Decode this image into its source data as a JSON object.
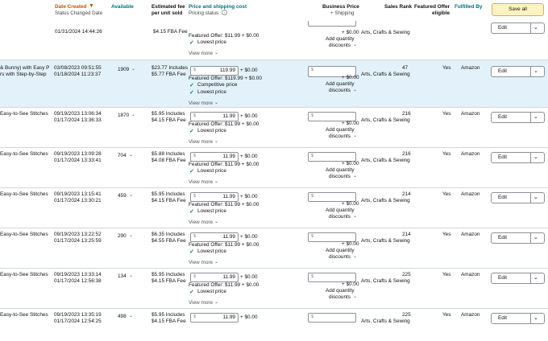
{
  "header": {
    "date_created": "Date Created",
    "date_sort_icon": "sort-down-icon",
    "status_changed_date": "Status Changed Date",
    "available": "Available",
    "estimated_fee": "Estimated fee",
    "per_unit_sold": "per unit sold",
    "price_shipping": "Price and shipping cost",
    "pricing_status": "Pricing status",
    "business_price": "Business Price",
    "plus_shipping": "+ Shipping",
    "sales_rank": "Sales Rank",
    "featured_offer": "Featured Offer",
    "eligible": "eligible",
    "fulfilled_by": "Fulfilled By",
    "save_all": "Save all"
  },
  "common": {
    "currency": "$",
    "plus_shipping_zero": "+ $0.00",
    "add_quantity": "Add quantity",
    "discounts": "discounts",
    "view_more": "View more",
    "lowest_price": "Lowest price",
    "competitive_price": "Competitive price",
    "category": "Arts, Crafts & Sewing",
    "edit": "Edit",
    "shipping_value": "+ $0.00"
  },
  "top_partial": {
    "date2": "01/31/2024 14:44:26",
    "fee2": "$4.15 FBA Fee",
    "featured": "Featured Offer: $11.99 + $0.00",
    "lowest": "Lowest price",
    "view_more": "View more",
    "biz_ship": "+ $0.00",
    "add_quantity": "Add quantity",
    "discounts": "discounts",
    "category": "Arts, Crafts & Sewing",
    "edit": "Edit"
  },
  "rows": [
    {
      "title1": "& Bunny) with Easy P",
      "title2": "rs with Step-by-Step",
      "date1": "03/08/2023 09:51:55",
      "date2": "01/18/2024 11:23:37",
      "available": "1909",
      "fee1": "$23.77 Includes",
      "fee2": "$5.77 FBA Fee",
      "price": "119.99",
      "featured": "Featured Offer: $119.99 + $0.00",
      "status1": "Competitive price",
      "status2": "Lowest price",
      "sales_rank": "47",
      "featured_eligible": "Yes",
      "fulfilled_by": "Amazon"
    },
    {
      "title1": "Easy-to-See Stitches",
      "date1": "09/19/2023 13:06:34",
      "date2": "01/17/2024 13:36:33",
      "available": "1870",
      "fee1": "$5.95 Includes",
      "fee2": "$4.15 FBA Fee",
      "price": "11.99",
      "featured": "Featured Offer: $11.99 + $0.00",
      "status1": "Lowest price",
      "sales_rank": "216",
      "featured_eligible": "Yes",
      "fulfilled_by": "Amazon"
    },
    {
      "title1": "Easy-to-See Stitches",
      "date1": "09/19/2023 13:09:28",
      "date2": "01/17/2024 13:33:41",
      "available": "704",
      "fee1": "$5.88 Includes",
      "fee2": "$4.08 FBA Fee",
      "price": "11.99",
      "featured": "Featured Offer: $11.99 + $0.00",
      "status1": "Lowest price",
      "sales_rank": "216",
      "featured_eligible": "Yes",
      "fulfilled_by": "Amazon"
    },
    {
      "title1": "Easy-to-See Stitches",
      "date1": "09/19/2023 13:15:41",
      "date2": "01/17/2024 13:30:21",
      "available": "459",
      "fee1": "$5.95 Includes",
      "fee2": "$4.15 FBA Fee",
      "price": "11.99",
      "featured": "Featured Offer: $11.99 + $0.00",
      "status1": "Lowest price",
      "sales_rank": "214",
      "featured_eligible": "Yes",
      "fulfilled_by": "Amazon"
    },
    {
      "title1": "Easy-to-See Stitches",
      "date1": "09/19/2023 13:22:52",
      "date2": "01/17/2024 13:25:59",
      "available": "290",
      "fee1": "$6.35 Includes",
      "fee2": "$4.55 FBA Fee",
      "price": "11.99",
      "featured": "Featured Offer: $11.99 + $0.00",
      "status1": "Lowest price",
      "sales_rank": "214",
      "featured_eligible": "Yes",
      "fulfilled_by": "Amazon"
    },
    {
      "title1": "Easy-to-See Stitches",
      "date1": "09/19/2023 13:33:14",
      "date2": "01/17/2024 12:56:38",
      "available": "134",
      "fee1": "$5.95 Includes",
      "fee2": "$4.15 FBA Fee",
      "price": "11.99",
      "featured": "Featured Offer: $11.99 + $0.00",
      "status1": "Lowest price",
      "sales_rank": "225",
      "featured_eligible": "Yes",
      "fulfilled_by": "Amazon"
    },
    {
      "title1": "Easy-to-See Stitches",
      "date1": "09/19/2023 13:35:19",
      "date2": "01/17/2024 12:54:25",
      "available": "498",
      "fee1": "$5.95 Includes",
      "fee2": "$4.15 FBA Fee",
      "price": "11.99",
      "featured": "",
      "status1": "",
      "sales_rank": "225",
      "featured_eligible": "Yes",
      "fulfilled_by": "Amazon"
    }
  ]
}
